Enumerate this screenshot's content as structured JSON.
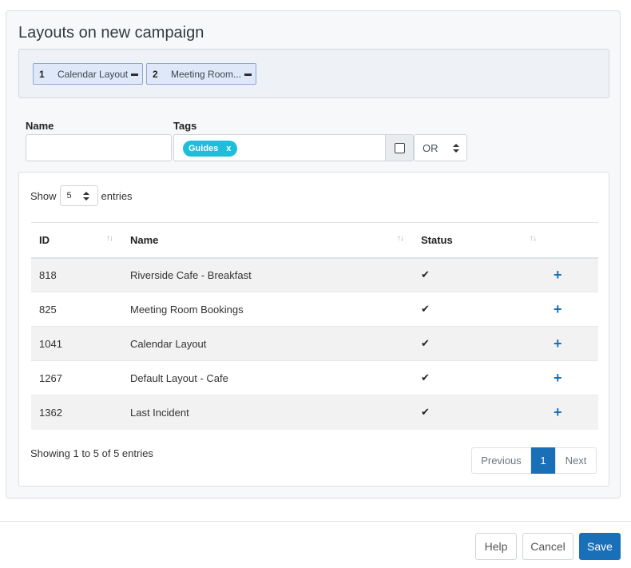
{
  "modal": {
    "title": "Layouts on new campaign",
    "selected_layouts": [
      {
        "num": "1",
        "name": "Calendar Layout"
      },
      {
        "num": "2",
        "name": "Meeting Room..."
      }
    ]
  },
  "filters": {
    "name_label": "Name",
    "name_value": "",
    "tags_label": "Tags",
    "tags": [
      "Guides"
    ],
    "tag_remove": "x",
    "operator": "OR"
  },
  "table": {
    "show_label": "Show",
    "entries_label": "entries",
    "page_length": "5",
    "columns": [
      "ID",
      "Name",
      "Status"
    ],
    "sort_icon": "↑↓",
    "rows": [
      {
        "id": "818",
        "name": "Riverside Cafe - Breakfast",
        "status": "✔",
        "add": "+"
      },
      {
        "id": "825",
        "name": "Meeting Room Bookings",
        "status": "✔",
        "add": "+"
      },
      {
        "id": "1041",
        "name": "Calendar Layout",
        "status": "✔",
        "add": "+"
      },
      {
        "id": "1267",
        "name": "Default Layout - Cafe",
        "status": "✔",
        "add": "+"
      },
      {
        "id": "1362",
        "name": "Last Incident",
        "status": "✔",
        "add": "+"
      }
    ],
    "info": "Showing 1 to 5 of 5 entries",
    "pagination": {
      "previous": "Previous",
      "current": "1",
      "next": "Next"
    }
  },
  "footer": {
    "help": "Help",
    "cancel": "Cancel",
    "save": "Save"
  },
  "colors": {
    "primary": "#1a70b8",
    "tag": "#1bbfd9",
    "chip_bg": "#dfe8f8",
    "chip_border": "#8ea7d8"
  },
  "icons": {
    "chip_remove": "minus-icon",
    "status": "check-icon",
    "row_add": "plus-icon",
    "select_caret": "caret-up-down-icon",
    "sort": "sort-icon"
  }
}
